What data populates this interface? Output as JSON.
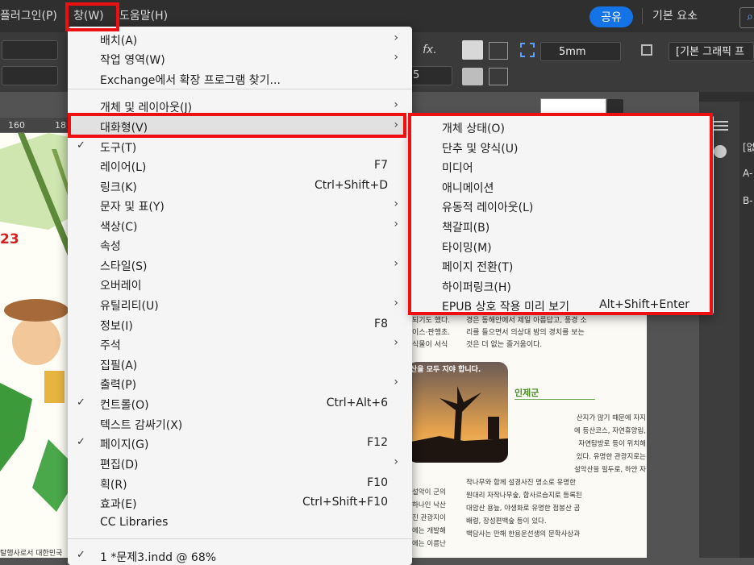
{
  "menubar": {
    "items": [
      {
        "label": "플러그인(P)"
      },
      {
        "label": "창(W)"
      },
      {
        "label": "도움말(H)"
      }
    ],
    "share_label": "공유",
    "workspace_label": "기본 요소",
    "workspace_chevron": "⌄",
    "search_icon": "⌕"
  },
  "control_bar": {
    "stroke_weight": "5mm",
    "fx_label": "fx.",
    "style_field": "[기본 그래픽 프",
    "field_value": "5"
  },
  "ruler": {
    "ticks": [
      "160",
      "18"
    ]
  },
  "document": {
    "page_number_fragment": "23",
    "bottom_text": "탈행사로서 대한민국",
    "right_col1": [
      "되기도 했다.",
      "이스·판행초.",
      "식물이 서식"
    ],
    "right_col2": [
      "경은 동해안에서 제일 아름답고, 풍경 소",
      "리를 들으면서 의상대 밤의 경치를 보는",
      "것은 더 없는 즐거움이다."
    ],
    "caption": "산을 모두 지야 합니다.",
    "section_title": "인제군",
    "body_lines": [
      "산지가 많기 때문에 자지",
      "에 등산코스, 자연휴양림,",
      "자연탐방로 등이 위치해",
      "있다. 유명한 관광지로는",
      "설악산을 필두로, 하얀 자",
      "작나무와 함께 설경사진 명소로 유명한",
      "원대리 자작나무숲, 합사르습지로 등록된",
      "대암산 용늪, 야생화로 유명한 점봉산 곰",
      "배령, 장성편백숲 등이 있다.",
      "백담사는 만해 한용운선생의 문학사상과"
    ],
    "left_lines": [
      "설악이 군의",
      "하나인 낙산",
      "진 관광지이",
      "에는 개발해",
      "에는 이름난"
    ]
  },
  "window_menu": {
    "items": [
      {
        "label": "배치(A)",
        "shortcut": "",
        "submenu": true,
        "checked": false
      },
      {
        "label": "작업 영역(W)",
        "shortcut": "",
        "submenu": true,
        "checked": false
      },
      {
        "label": "Exchange에서 확장 프로그램 찾기...",
        "shortcut": "",
        "submenu": false,
        "checked": false
      },
      {
        "label": "개체 및 레이아웃(J)",
        "shortcut": "",
        "submenu": true,
        "checked": false
      },
      {
        "label": "대화형(V)",
        "shortcut": "",
        "submenu": true,
        "checked": false,
        "highlighted": true
      },
      {
        "label": "도구(T)",
        "shortcut": "",
        "submenu": false,
        "checked": true
      },
      {
        "label": "레이어(L)",
        "shortcut": "F7",
        "submenu": false,
        "checked": false
      },
      {
        "label": "링크(K)",
        "shortcut": "Ctrl+Shift+D",
        "submenu": false,
        "checked": false
      },
      {
        "label": "문자 및 표(Y)",
        "shortcut": "",
        "submenu": true,
        "checked": false
      },
      {
        "label": "색상(C)",
        "shortcut": "",
        "submenu": true,
        "checked": false
      },
      {
        "label": "속성",
        "shortcut": "",
        "submenu": false,
        "checked": false
      },
      {
        "label": "스타일(S)",
        "shortcut": "",
        "submenu": true,
        "checked": false
      },
      {
        "label": "오버레이",
        "shortcut": "",
        "submenu": false,
        "checked": false
      },
      {
        "label": "유틸리티(U)",
        "shortcut": "",
        "submenu": true,
        "checked": false
      },
      {
        "label": "정보(I)",
        "shortcut": "F8",
        "submenu": false,
        "checked": false
      },
      {
        "label": "주석",
        "shortcut": "",
        "submenu": true,
        "checked": false
      },
      {
        "label": "집필(A)",
        "shortcut": "",
        "submenu": false,
        "checked": false
      },
      {
        "label": "출력(P)",
        "shortcut": "",
        "submenu": true,
        "checked": false
      },
      {
        "label": "컨트롤(O)",
        "shortcut": "Ctrl+Alt+6",
        "submenu": false,
        "checked": true
      },
      {
        "label": "텍스트 감싸기(X)",
        "shortcut": "",
        "submenu": false,
        "checked": false
      },
      {
        "label": "페이지(G)",
        "shortcut": "F12",
        "submenu": false,
        "checked": true
      },
      {
        "label": "편집(D)",
        "shortcut": "",
        "submenu": true,
        "checked": false
      },
      {
        "label": "획(R)",
        "shortcut": "F10",
        "submenu": false,
        "checked": false
      },
      {
        "label": "효과(E)",
        "shortcut": "Ctrl+Shift+F10",
        "submenu": false,
        "checked": false
      },
      {
        "label": "CC Libraries",
        "shortcut": "",
        "submenu": false,
        "checked": false
      },
      {
        "label": "1 *문제3.indd @ 68%",
        "shortcut": "",
        "submenu": false,
        "checked": true
      }
    ]
  },
  "interactive_submenu": {
    "items": [
      {
        "label": "개체 상태(O)",
        "shortcut": ""
      },
      {
        "label": "단추 및 양식(U)",
        "shortcut": ""
      },
      {
        "label": "미디어",
        "shortcut": ""
      },
      {
        "label": "애니메이션",
        "shortcut": ""
      },
      {
        "label": "유동적 레이아웃(L)",
        "shortcut": ""
      },
      {
        "label": "책갈피(B)",
        "shortcut": ""
      },
      {
        "label": "타이밍(M)",
        "shortcut": ""
      },
      {
        "label": "페이지 전환(T)",
        "shortcut": ""
      },
      {
        "label": "하이퍼링크(H)",
        "shortcut": ""
      },
      {
        "label": "EPUB 상호 작용 미리 보기",
        "shortcut": "Alt+Shift+Enter"
      }
    ]
  },
  "right_panel": {
    "labels": [
      "[없",
      "A-",
      "B-"
    ]
  },
  "colors": {
    "accent": "#1473e6",
    "annotation": "#ee1010",
    "menu_bg": "#f5f5f5",
    "highlight": "#e1e1e1"
  }
}
